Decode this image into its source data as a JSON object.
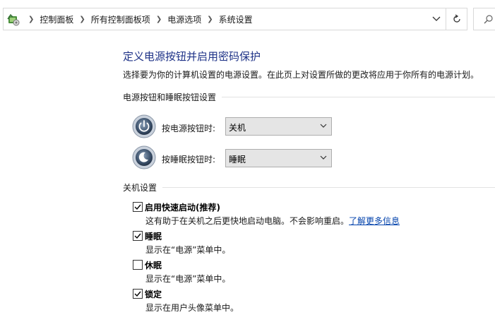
{
  "breadcrumb": {
    "items": [
      "控制面板",
      "所有控制面板项",
      "电源选项",
      "系统设置"
    ]
  },
  "page": {
    "title": "定义电源按钮并启用密码保护",
    "description": "选择要为你的计算机设置的电源设置。在此页上对设置所做的更改将应用于你所有的电源计划。"
  },
  "power_buttons": {
    "group_label": "电源按钮和睡眠按钮设置",
    "power": {
      "label": "按电源按钮时:",
      "value": "关机"
    },
    "sleep": {
      "label": "按睡眠按钮时:",
      "value": "睡眠"
    }
  },
  "shutdown": {
    "group_label": "关机设置",
    "items": [
      {
        "label": "启用快速启动(推荐)",
        "checked": true,
        "desc": "这有助于在关机之后更快地启动电脑。不会影响重启。",
        "link": "了解更多信息"
      },
      {
        "label": "睡眠",
        "checked": true,
        "desc": "显示在“电源”菜单中。"
      },
      {
        "label": "休眠",
        "checked": false,
        "desc": "显示在“电源”菜单中。"
      },
      {
        "label": "锁定",
        "checked": true,
        "desc": "显示在用户头像菜单中。"
      }
    ]
  },
  "colors": {
    "title": "#1e3287",
    "link": "#0645ad"
  },
  "icons": {
    "address": "control-panel-icon",
    "dropdown": "chevron-down-icon",
    "refresh": "refresh-icon",
    "search": "search-icon",
    "power": "power-button-icon",
    "sleep": "sleep-button-icon"
  }
}
